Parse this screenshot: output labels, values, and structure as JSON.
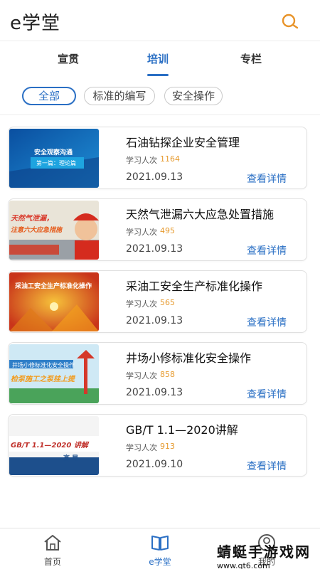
{
  "header": {
    "title": "e学堂",
    "search_icon": "search-icon"
  },
  "tabs": [
    {
      "label": "宣贯",
      "active": false
    },
    {
      "label": "培训",
      "active": true
    },
    {
      "label": "专栏",
      "active": false
    }
  ],
  "filters": [
    {
      "label": "全部",
      "active": true
    },
    {
      "label": "标准的编写",
      "active": false
    },
    {
      "label": "安全操作",
      "active": false
    }
  ],
  "courses": [
    {
      "title": "石油钻探企业安全管理",
      "learn_label": "学习人次",
      "count": "1164",
      "date": "2021.09.13",
      "detail": "查看详情",
      "thumb_text": [
        "安全观察沟通",
        "第一篇：理论篇"
      ]
    },
    {
      "title": "天然气泄漏六大应急处置措施",
      "learn_label": "学习人次",
      "count": "495",
      "date": "2021.09.13",
      "detail": "查看详情",
      "thumb_text": [
        "天然气泄漏，",
        "注意六大应急措施"
      ]
    },
    {
      "title": "采油工安全生产标准化操作",
      "learn_label": "学习人次",
      "count": "565",
      "date": "2021.09.13",
      "detail": "查看详情",
      "thumb_text": [
        "采油工安全生产标准化操作"
      ]
    },
    {
      "title": "井场小修标准化安全操作",
      "learn_label": "学习人次",
      "count": "858",
      "date": "2021.09.13",
      "detail": "查看详情",
      "thumb_text": [
        "井场小修标准化安全操作",
        "检泵施工之泵挂上提"
      ]
    },
    {
      "title": "GB/T 1.1—2020讲解",
      "learn_label": "学习人次",
      "count": "913",
      "date": "2021.09.10",
      "detail": "查看详情",
      "thumb_text": [
        "GB/T 1.1—2020 讲解",
        "高 昂"
      ]
    }
  ],
  "bottom_nav": [
    {
      "label": "首页",
      "icon": "home-icon",
      "active": false
    },
    {
      "label": "e学堂",
      "icon": "book-icon",
      "active": true
    },
    {
      "label": "我的",
      "icon": "profile-icon",
      "active": false
    }
  ],
  "watermark": {
    "text": "蜻蜓手游戏网",
    "url": "www.qt6.com"
  },
  "colors": {
    "accent": "#2a6fc4",
    "count": "#e69a2e",
    "search": "#e8942a"
  }
}
